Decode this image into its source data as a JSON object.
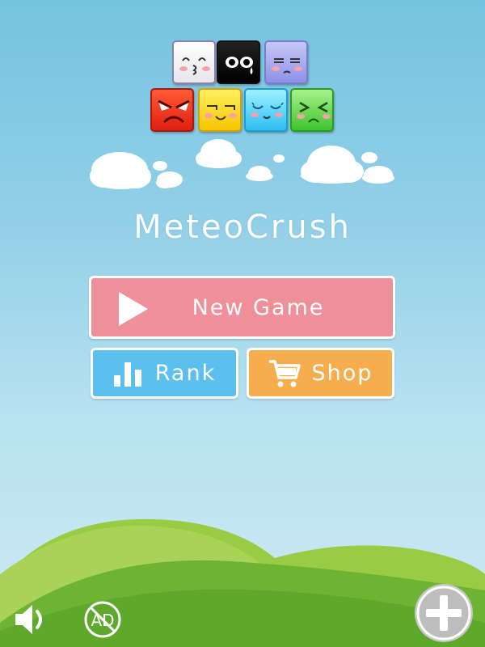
{
  "game": {
    "title": "MeteoCrush"
  },
  "logo": {
    "blocks": [
      {
        "face": "kissing",
        "color": "#ffffff"
      },
      {
        "face": "crying",
        "color": "#111111"
      },
      {
        "face": "sleepy",
        "color": "#a9abf0"
      },
      {
        "face": "angry",
        "color": "#f0301a"
      },
      {
        "face": "content",
        "color": "#fadc1e"
      },
      {
        "face": "happy-closed-eyes",
        "color": "#5fd6f8"
      },
      {
        "face": "squinting",
        "color": "#66d94a"
      }
    ]
  },
  "menu": {
    "new_game": {
      "label": "New Game",
      "icon": "play-icon",
      "color": "#ef8f9a"
    },
    "rank": {
      "label": "Rank",
      "icon": "bar-chart-icon",
      "color": "#5cc0ee"
    },
    "shop": {
      "label": "Shop",
      "icon": "cart-icon",
      "color": "#f6ad4d"
    }
  },
  "controls": {
    "sound": {
      "icon": "speaker-icon",
      "state": "on"
    },
    "no_ads": {
      "icon": "no-ads-icon",
      "text": "AD"
    },
    "more": {
      "icon": "plus-icon"
    }
  },
  "colors": {
    "sky_top": "#74c3e0",
    "sky_bottom": "#cdeaf3",
    "hill_back": "#8cc63e",
    "hill_front": "#5fae2e"
  }
}
